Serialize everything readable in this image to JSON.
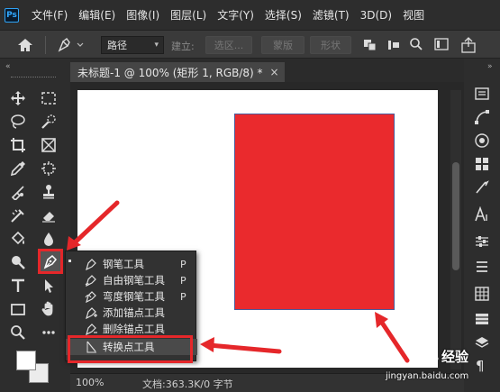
{
  "menubar": {
    "items": [
      "文件(F)",
      "编辑(E)",
      "图像(I)",
      "图层(L)",
      "文字(Y)",
      "选择(S)",
      "滤镜(T)",
      "3D(D)",
      "视图"
    ]
  },
  "options": {
    "mode_select": "路径",
    "build_label": "建立:",
    "selection_btn": "选区...",
    "mask_btn": "蒙版",
    "shape_btn": "形状"
  },
  "document": {
    "tab_title": "未标题-1 @ 100% (矩形 1, RGB/8) *",
    "tab_close": "×",
    "shape_color": "#ea2a2d"
  },
  "status": {
    "zoom": "100%",
    "doc_info": "文档:363.3K/0 字节"
  },
  "flyout": {
    "items": [
      {
        "label": "钢笔工具",
        "key": "P"
      },
      {
        "label": "自由钢笔工具",
        "key": "P"
      },
      {
        "label": "弯度钢笔工具",
        "key": "P"
      },
      {
        "label": "添加锚点工具",
        "key": ""
      },
      {
        "label": "删除锚点工具",
        "key": ""
      },
      {
        "label": "转换点工具",
        "key": ""
      }
    ]
  },
  "watermark": {
    "text": "经验",
    "url": "jingyan.baidu.com"
  },
  "colors": {
    "highlight": "#e5272a"
  }
}
